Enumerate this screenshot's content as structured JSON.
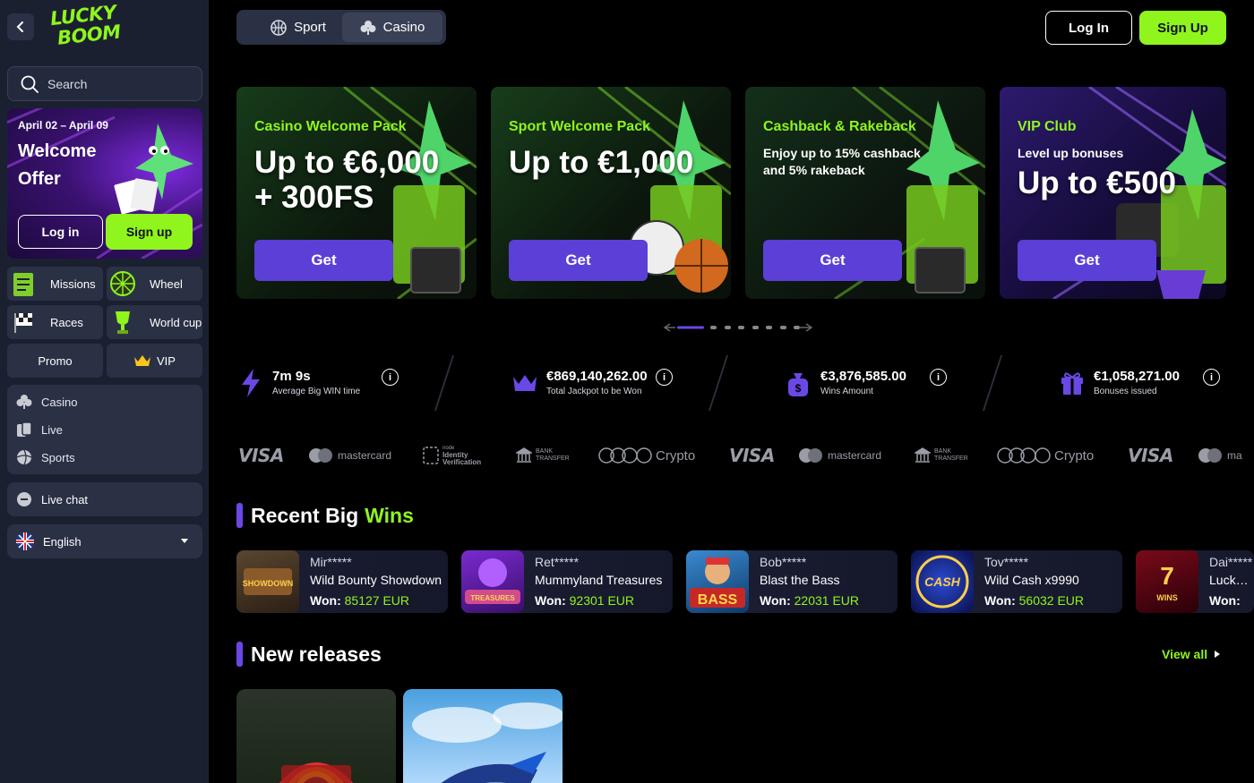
{
  "brand": {
    "logo_line1": "LUCKY",
    "logo_line2": "BOOM",
    "accent": "#8ff51d",
    "primary": "#5b3fd6"
  },
  "sidebar": {
    "search_label": "Search",
    "promo": {
      "dates": "April 02 – April 09",
      "title": "Welcome Offer",
      "login": "Log in",
      "signup": "Sign up"
    },
    "tiles": [
      {
        "label": "Missions",
        "icon": "clipboard-icon"
      },
      {
        "label": "Wheel",
        "icon": "wheel-icon"
      },
      {
        "label": "Races",
        "icon": "race-flag-icon"
      },
      {
        "label": "World cup",
        "icon": "trophy-icon"
      }
    ],
    "promo_btn": "Promo",
    "vip_btn": "VIP",
    "menu": [
      {
        "label": "Casino",
        "icon": "club-icon"
      },
      {
        "label": "Live",
        "icon": "live-cards-icon"
      },
      {
        "label": "Sports",
        "icon": "sports-ball-icon"
      }
    ],
    "live_chat": "Live chat",
    "language": "English"
  },
  "header": {
    "tabs": [
      {
        "label": "Sport",
        "active": false
      },
      {
        "label": "Casino",
        "active": true
      }
    ],
    "login": "Log In",
    "signup": "Sign Up"
  },
  "banners": [
    {
      "subtitle": "Casino Welcome Pack",
      "headline1": "Up to €6,000",
      "headline2": "+ 300FS",
      "text": "",
      "cta": "Get"
    },
    {
      "subtitle": "Sport Welcome Pack",
      "headline1": "Up to €1,000",
      "headline2": "",
      "text": "",
      "cta": "Get"
    },
    {
      "subtitle": "Cashback & Rakeback",
      "headline1": "",
      "headline2": "",
      "text": "Enjoy up to 15% cashback and 5% rakeback",
      "cta": "Get"
    },
    {
      "subtitle": "VIP Club",
      "headline1": "Up to €500",
      "headline2": "",
      "text": "Level up bonuses",
      "cta": "Get"
    }
  ],
  "stats": [
    {
      "value": "7m 9s",
      "caption": "Average Big WIN time",
      "icon": "lightning-icon"
    },
    {
      "value": "€869,140,262.00",
      "caption": "Total Jackpot to be Won",
      "icon": "crown-icon"
    },
    {
      "value": "€3,876,585.00",
      "caption": "Wins Amount",
      "icon": "money-bag-icon"
    },
    {
      "value": "€1,058,271.00",
      "caption": "Bonuses issued",
      "icon": "gift-icon"
    }
  ],
  "payments": {
    "visa": "VISA",
    "mastercard": "mastercard",
    "identity_top": "node",
    "identity": "Identity Verification",
    "bank": "BANK TRANSFER",
    "crypto": "Crypto",
    "mastercard_cut": "ma"
  },
  "recent_wins": {
    "title": "Recent Big",
    "title_highlight": "Wins",
    "won_label": "Won:",
    "items": [
      {
        "user": "Mir*****",
        "game": "Wild Bounty Showdown",
        "amount": "85127 EUR",
        "thumb": "SHOWDOWN"
      },
      {
        "user": "Ret*****",
        "game": "Mummyland Treasures",
        "amount": "92301 EUR",
        "thumb": "TREASURES"
      },
      {
        "user": "Bob*****",
        "game": "Blast the Bass",
        "amount": "22031 EUR",
        "thumb": "BASS"
      },
      {
        "user": "Tov*****",
        "game": "Wild Cash x9990",
        "amount": "56032 EUR",
        "thumb": "CASH"
      },
      {
        "user": "Dai*****",
        "game": "Lucky Penny Wins",
        "amount": "",
        "thumb": "WINS"
      }
    ]
  },
  "new_releases": {
    "title": "New releases",
    "view_all": "View all"
  }
}
